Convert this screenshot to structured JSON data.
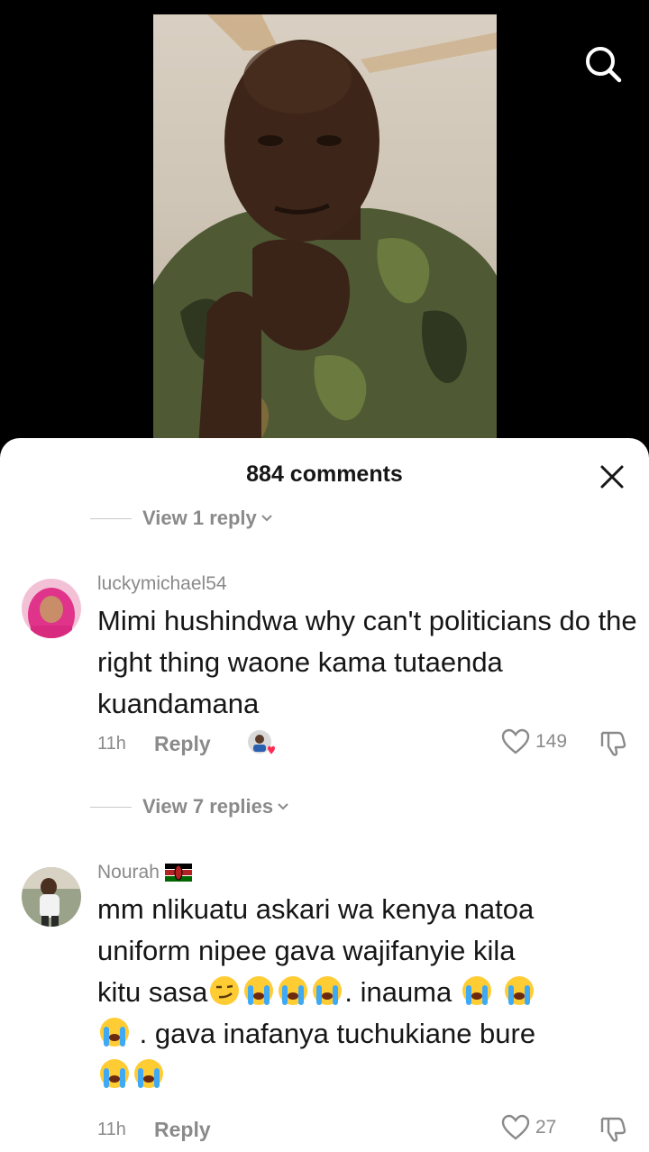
{
  "video": {
    "search_icon": "search-icon"
  },
  "sheet": {
    "title": "884 comments",
    "close_icon": "close-icon"
  },
  "view_replies_1": "View 1 reply",
  "comment_1": {
    "username": "luckymichael54",
    "text": "Mimi hushindwa why can't politicians do the right thing waone kama tutaenda kuandamana",
    "time": "11h",
    "reply_label": "Reply",
    "likes": "149",
    "creator_liked": true
  },
  "view_replies_2": "View 7 replies",
  "comment_2": {
    "username": "Nourah",
    "flag": "kenya-flag",
    "text_lines": [
      "mm nlikuatu askari wa kenya natoa",
      "uniform nipee gava wajifanyie kila",
      "kitu sasa",
      ". inauma",
      ". gava inafanya tuchukiane bure"
    ],
    "time": "11h",
    "reply_label": "Reply",
    "likes": "27"
  },
  "colors": {
    "text_primary": "#161616",
    "text_secondary": "#8a8a8a",
    "like_heart": "#fe2c55"
  }
}
